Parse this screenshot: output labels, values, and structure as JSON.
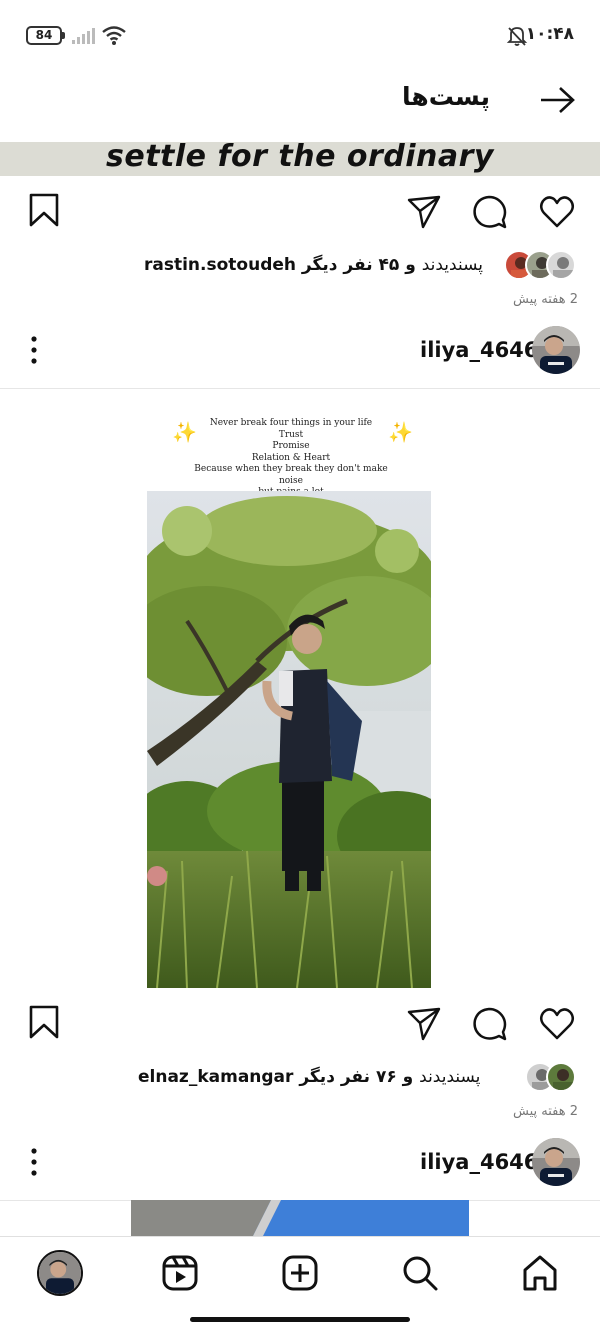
{
  "status_bar": {
    "battery": "84",
    "time": "۱۰:۴۸",
    "icons": [
      "battery-icon",
      "cellular-signal-icon",
      "wifi-icon",
      "bell-muted-icon"
    ]
  },
  "header": {
    "title": "پست‌ها",
    "back_icon": "arrow-right-icon"
  },
  "banner_text": "settle for the ordinary",
  "posts": [
    {
      "actions": [
        "heart-icon",
        "comment-icon",
        "share-icon",
        "bookmark-icon"
      ],
      "liked_by": "rastin.sotoudeh",
      "likes_text": "پسندیدند",
      "others_text": "و ۴۵ نفر دیگر",
      "time_ago": "2 هفته پیش"
    },
    {
      "username": "iliya_4646",
      "more_icon": "more-vertical-icon",
      "quote_lines": [
        "Never break four things in your life",
        "Trust",
        "Promise",
        "Relation & Heart",
        "Because when they break they don't make noise",
        "but pains a lot"
      ],
      "sparkle": "✨",
      "actions": [
        "heart-icon",
        "comment-icon",
        "share-icon",
        "bookmark-icon"
      ],
      "liked_by": "elnaz_kamangar",
      "likes_text": "پسندیدند",
      "others_text": "و ۷۶ نفر دیگر",
      "time_ago": "2 هفته پیش"
    },
    {
      "username": "iliya_4646",
      "more_icon": "more-vertical-icon"
    }
  ],
  "bottom_nav": [
    "profile-avatar",
    "reels-icon",
    "add-post-icon",
    "search-icon",
    "home-icon"
  ],
  "colors": {
    "text": "#111111",
    "muted": "#777777",
    "banner_bg": "#dcdcd4",
    "divider": "#e6e6e6"
  }
}
